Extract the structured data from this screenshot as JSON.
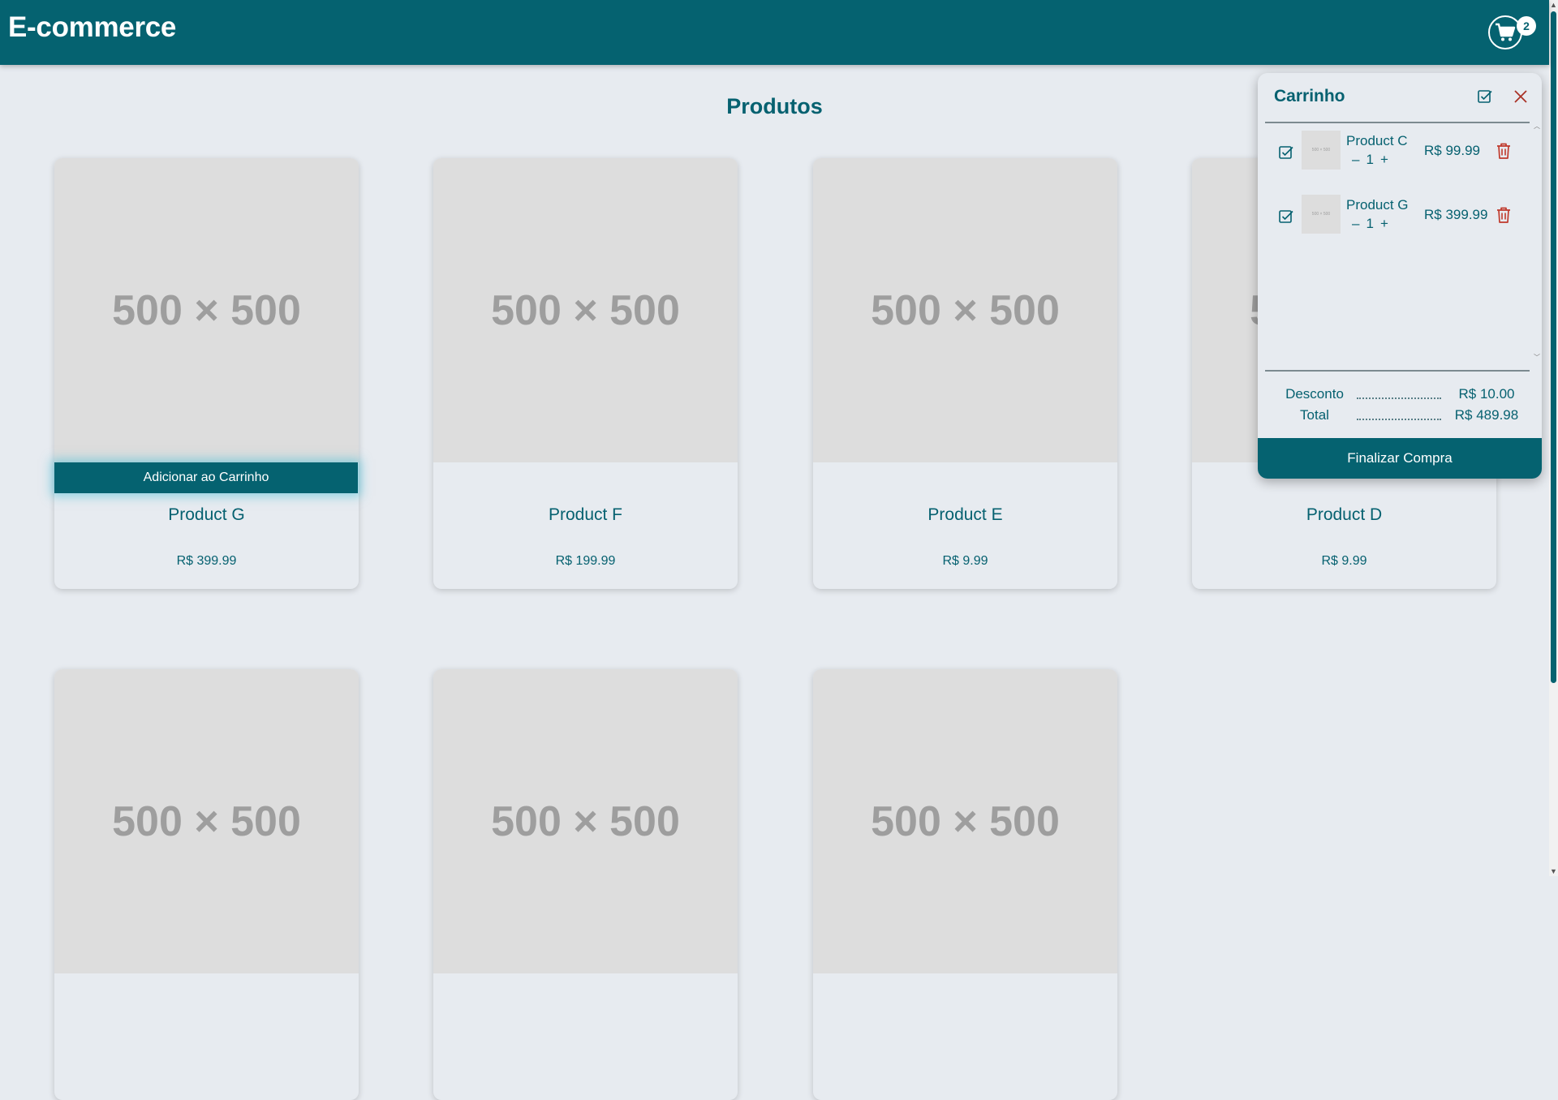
{
  "header": {
    "brand": "E-commerce",
    "cart_count": "2"
  },
  "page": {
    "title": "Produtos",
    "add_to_cart_label": "Adicionar ao Carrinho",
    "placeholder_text": "500 × 500"
  },
  "products": [
    {
      "name": "Product G",
      "price": "R$ 399.99"
    },
    {
      "name": "Product F",
      "price": "R$ 199.99"
    },
    {
      "name": "Product E",
      "price": "R$ 9.99"
    },
    {
      "name": "Product D",
      "price": "R$ 9.99"
    },
    {
      "name": "",
      "price": ""
    },
    {
      "name": "",
      "price": ""
    },
    {
      "name": "",
      "price": ""
    }
  ],
  "cart": {
    "title": "Carrinho",
    "items": [
      {
        "name": "Product C",
        "quantity": "1",
        "minus": "–",
        "plus": "+",
        "price": "R$ 99.99",
        "thumb_text": "500 × 500"
      },
      {
        "name": "Product G",
        "quantity": "1",
        "minus": "–",
        "plus": "+",
        "price": "R$ 399.99",
        "thumb_text": "500 × 500"
      }
    ],
    "discount_label": "Desconto",
    "discount_value": "R$ 10.00",
    "total_label": "Total",
    "total_value": "R$ 489.98",
    "checkout_label": "Finalizar Compra"
  },
  "colors": {
    "primary": "#056270",
    "background": "#e7ebf0",
    "danger": "#c0392b"
  },
  "icons": {
    "cart": "shopping-cart-icon",
    "close": "close-icon",
    "check": "checkbox-checked-icon",
    "trash": "trash-icon"
  }
}
